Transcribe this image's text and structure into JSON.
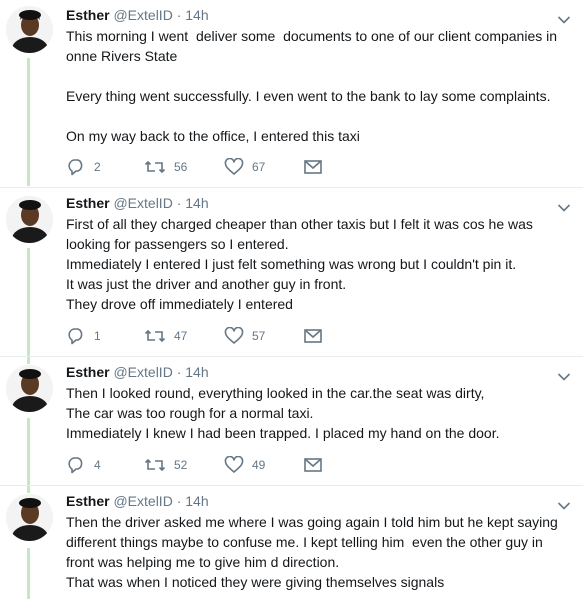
{
  "tweets": [
    {
      "name": "Esther",
      "handle": "@ExtelID",
      "dot": "·",
      "time": "14h",
      "paragraphs": [
        "This morning I went  deliver some  documents to one of our client companies in\nonne Rivers State",
        "Every thing went successfully. I even went to the bank to lay some complaints.",
        "On my way back to the office, I entered this taxi"
      ],
      "replies": "2",
      "retweets": "56",
      "likes": "67"
    },
    {
      "name": "Esther",
      "handle": "@ExtelID",
      "dot": "·",
      "time": "14h",
      "paragraphs": [
        "First of all they charged cheaper than other taxis but I felt it was cos he was\nlooking for passengers so I entered.\nImmediately I entered I just felt something was wrong but I couldn't pin it.\nIt was just the driver and another guy in front.\nThey drove off immediately I entered"
      ],
      "replies": "1",
      "retweets": "47",
      "likes": "57"
    },
    {
      "name": "Esther",
      "handle": "@ExtelID",
      "dot": "·",
      "time": "14h",
      "paragraphs": [
        "Then I looked round, everything looked in the car.the seat was dirty,\nThe car was too rough for a normal taxi.\nImmediately I knew I had been trapped. I placed my hand on the door."
      ],
      "replies": "4",
      "retweets": "52",
      "likes": "49"
    },
    {
      "name": "Esther",
      "handle": "@ExtelID",
      "dot": "·",
      "time": "14h",
      "paragraphs": [
        "Then the driver asked me where I was going again I told him but he kept saying\ndifferent things maybe to confuse me. I kept telling him  even the other guy in\nfront was helping me to give him d direction.\nThat was when I noticed they were giving themselves signals"
      ]
    }
  ],
  "icons": {
    "reply": "reply-icon",
    "retweet": "retweet-icon",
    "like": "heart-icon",
    "message": "envelope-icon",
    "menu": "chevron-down-icon"
  },
  "colors": {
    "text": "#14171a",
    "secondary": "#657786",
    "thread_line": "#c4e7c4",
    "divider": "#e6ecf0"
  }
}
